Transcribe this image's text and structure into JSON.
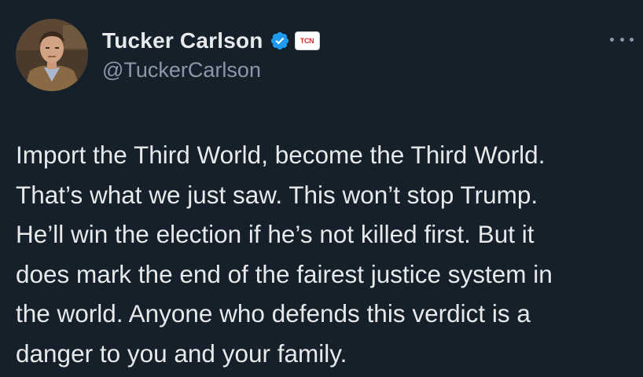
{
  "author": {
    "display_name": "Tucker Carlson",
    "handle": "@TuckerCarlson",
    "affiliate_badge": "TCN",
    "verified_color": "#1d9bf0"
  },
  "tweet": {
    "lines": [
      "Import the Third World, become the Third World.",
      "That’s what we just saw. This won’t stop Trump.",
      "He’ll win the election if he’s not killed first. But it",
      "does mark the end of the fairest justice system in",
      "the world. Anyone who defends this verdict is a",
      "danger to you and your family."
    ]
  },
  "icons": {
    "more": "more-options-icon",
    "verified": "verified-badge-icon",
    "affiliate": "affiliate-badge-icon"
  },
  "theme": {
    "background": "#15202b",
    "text": "#e7e9ea",
    "secondary_text": "#8b98a5"
  }
}
